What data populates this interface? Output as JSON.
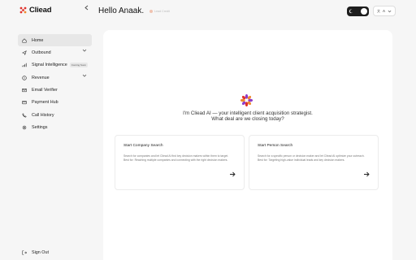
{
  "app": {
    "name": "Cliead"
  },
  "sidebar": {
    "collapse_icon": "chevron-left-icon",
    "items": [
      {
        "label": "Home",
        "icon": "home-icon",
        "active": true
      },
      {
        "label": "Outbound",
        "icon": "send-icon",
        "has_chevron": true
      },
      {
        "label": "Signal Intelligence",
        "icon": "signal-icon",
        "badge": "Coming Soon"
      },
      {
        "label": "Revenue",
        "icon": "dollar-icon",
        "has_chevron": true
      },
      {
        "label": "Email Verifier",
        "icon": "mail-icon"
      },
      {
        "label": "Payment Hub",
        "icon": "card-icon"
      },
      {
        "label": "Call History",
        "icon": "phone-icon"
      },
      {
        "label": "Settings",
        "icon": "gear-icon"
      }
    ],
    "sign_out": "Sign Out"
  },
  "header": {
    "greeting": "Hello Anaak.",
    "badge": "Lead Credit",
    "lang": "A"
  },
  "main": {
    "intro_line1": "I'm Cliead AI — your intelligent client acquisition strategist.",
    "intro_line2": "What deal are we closing today?",
    "cards": [
      {
        "title": "Start Company Search",
        "desc": "Search for companies and let Cliead AI find key decision makers within them to target. Best for: Reaching multiple companies and connecting with the right decision makers."
      },
      {
        "title": "Start Person Search",
        "desc": "Search for a specific person or decision maker and let Cliead AI optimize your outreach. Best for: Targeting high-value individual leads and key decision makers."
      }
    ]
  },
  "colors": {
    "accent": "#8e3cc9",
    "brand_red": "#e0322b",
    "brand_orange": "#f08a2e"
  }
}
